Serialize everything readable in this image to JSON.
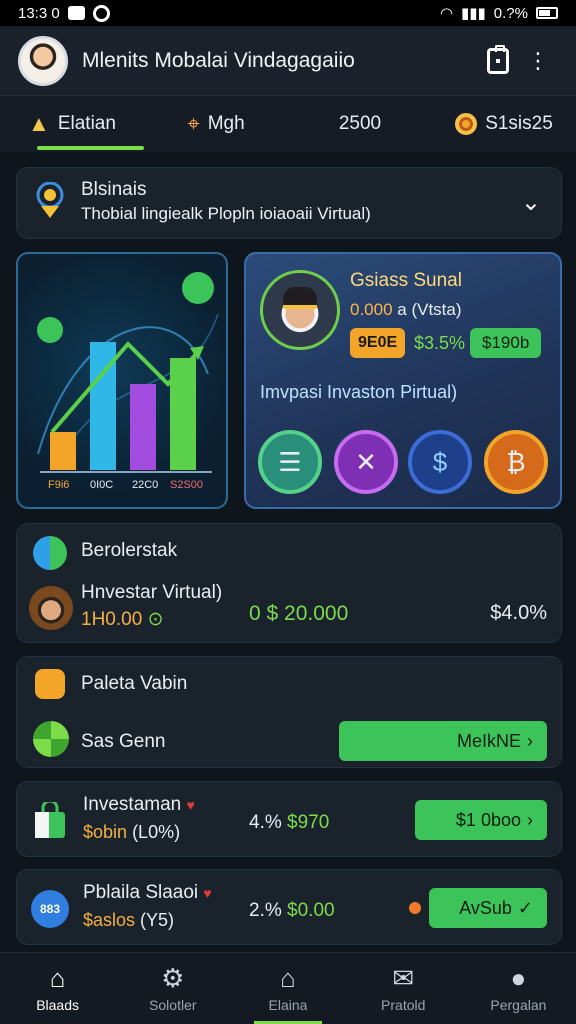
{
  "status_bar": {
    "time": "13:3 0",
    "battery_text": "0.?%"
  },
  "app": {
    "title": "Mlenits Mobalai Vindagagaiio"
  },
  "tabs": [
    {
      "label": "Elatian",
      "icon": "warning-icon"
    },
    {
      "label": "Mgh",
      "icon": "location-pin-icon"
    },
    {
      "label": "2500",
      "icon": ""
    },
    {
      "label": "S1sis25",
      "icon": "coin-icon"
    }
  ],
  "selector": {
    "label": "Blsinais",
    "subtitle": "Thobial lingiealk Plopln ioiaoaii Virtual)"
  },
  "chart_card": {
    "axis_labels": [
      "F9i6",
      "0I0C",
      "22C0",
      "S2S00"
    ]
  },
  "profile": {
    "name": "Gsiass Sunal",
    "sub_value": "0.000",
    "sub_text": "a (Vtsta)",
    "badge": "9E0E",
    "percent": "$3.5%",
    "amount": "$190b",
    "caption": "Imvpasi Invaston Pirtual)"
  },
  "balance": {
    "title": "Berolerstak",
    "label": "Hnvestar Virtual)",
    "value": "1H0.00",
    "value_icon": "check-circle-icon",
    "mid": "0 $ 20.000",
    "right": "$4.0%"
  },
  "wallet": {
    "title": "Paleta Vabin",
    "subtitle": "Sas Genn",
    "button": "MeIkNE"
  },
  "rows": [
    {
      "title": "Investaman",
      "sub_value": "$obin",
      "sub_pct": "(L0%)",
      "pct": "4.%",
      "amount": "$970",
      "button": "$1 0boo"
    },
    {
      "title": "Pblaila Slaaoi",
      "badge": "883",
      "sub_value": "$aslos",
      "sub_pct": "(Y5)",
      "pct": "2.%",
      "amount": "$0.00",
      "button": "AvSub"
    }
  ],
  "bottom_nav": [
    {
      "label": "Blaads",
      "icon": "home-icon"
    },
    {
      "label": "Solotler",
      "icon": "gear-icon"
    },
    {
      "label": "Elaina",
      "icon": "house-icon"
    },
    {
      "label": "Pratold",
      "icon": "mail-icon"
    },
    {
      "label": "Pergalan",
      "icon": "user-icon"
    }
  ],
  "colors": {
    "accent_green": "#7ddc4a",
    "accent_orange": "#f3a52a",
    "background": "#0f151d"
  }
}
